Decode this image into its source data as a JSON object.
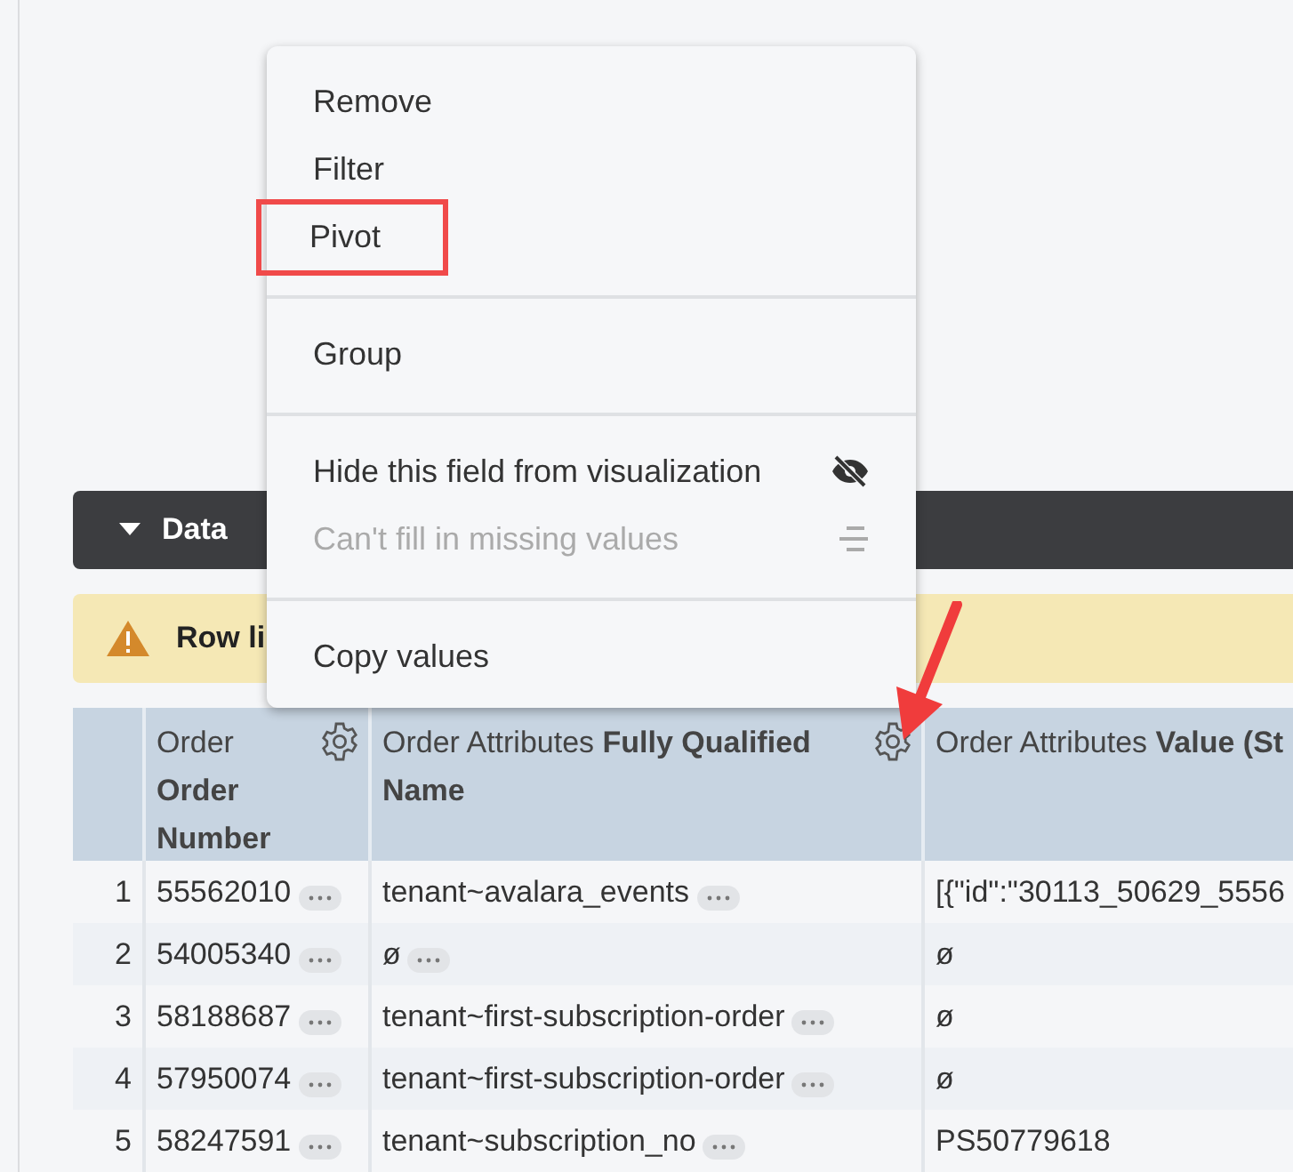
{
  "data_section": {
    "title": "Data",
    "expanded": true
  },
  "warning": {
    "text": "Row li"
  },
  "table": {
    "columns": [
      {
        "label": "Order **Order Number**",
        "gear": true
      },
      {
        "label": "Order Attributes **Fully Qualified Name**",
        "gear": true
      },
      {
        "label": "Order Attributes **Value (St**",
        "gear": false
      }
    ],
    "rows": [
      {
        "index": "1",
        "cells": [
          {
            "text": "55562010",
            "more": true
          },
          {
            "text": "tenant~avalara_events",
            "more": true
          },
          {
            "text": "[{\"id\":\"30113_50629_5556",
            "more": false
          }
        ]
      },
      {
        "index": "2",
        "cells": [
          {
            "text": "54005340",
            "more": true
          },
          {
            "text": "ø",
            "more": true
          },
          {
            "text": "ø",
            "more": false
          }
        ]
      },
      {
        "index": "3",
        "cells": [
          {
            "text": "58188687",
            "more": true
          },
          {
            "text": "tenant~first-subscription-order",
            "more": true
          },
          {
            "text": "ø",
            "more": false
          }
        ]
      },
      {
        "index": "4",
        "cells": [
          {
            "text": "57950074",
            "more": true
          },
          {
            "text": "tenant~first-subscription-order",
            "more": true
          },
          {
            "text": "ø",
            "more": false
          }
        ]
      },
      {
        "index": "5",
        "cells": [
          {
            "text": "58247591",
            "more": true
          },
          {
            "text": "tenant~subscription_no",
            "more": true
          },
          {
            "text": "PS50779618",
            "more": false
          }
        ]
      }
    ]
  },
  "context_menu": {
    "items": [
      {
        "kind": "action",
        "label": "Remove",
        "disabled": false,
        "highlighted": false
      },
      {
        "kind": "action",
        "label": "Filter",
        "disabled": false,
        "highlighted": false
      },
      {
        "kind": "action",
        "label": "Pivot",
        "disabled": false,
        "highlighted": true
      },
      {
        "kind": "divider"
      },
      {
        "kind": "action",
        "label": "Group",
        "disabled": false,
        "highlighted": false
      },
      {
        "kind": "divider"
      },
      {
        "kind": "hide-action",
        "label": "Hide this field from visualization",
        "disabled": false,
        "highlighted": false
      },
      {
        "kind": "fill-action",
        "label": "Can't fill in missing values",
        "disabled": true,
        "highlighted": false
      },
      {
        "kind": "divider"
      },
      {
        "kind": "action",
        "label": "Copy values",
        "disabled": false,
        "highlighted": false
      }
    ]
  },
  "annotation": {
    "arrow": true
  }
}
